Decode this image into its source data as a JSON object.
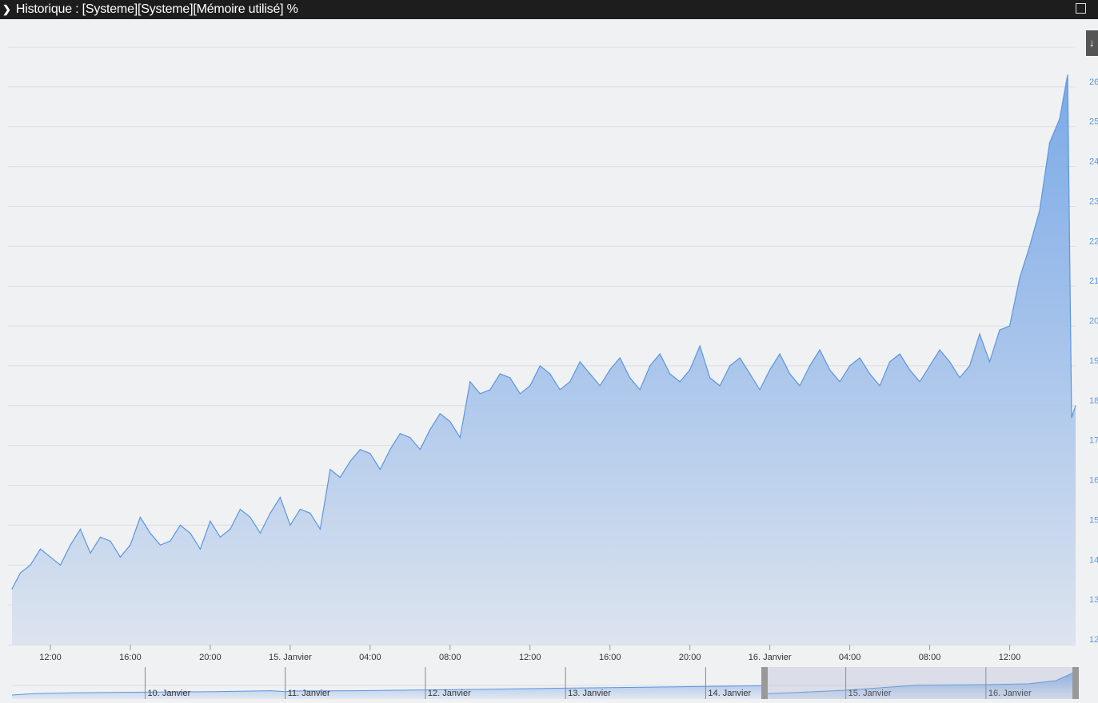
{
  "window": {
    "title": "Historique : [Systeme][Systeme][Mémoire utilisé] %",
    "expand_icon": "chevron-right-icon",
    "maximize_icon": "square-icon",
    "download_icon": "download-icon"
  },
  "chart_data": {
    "type": "area",
    "title": "Historique : [Systeme][Systeme][Mémoire utilisé] %",
    "xlabel": "",
    "ylabel": "",
    "x_unit": "hours since 14 Janvier 10:00",
    "ylim": [
      12,
      27
    ],
    "yticks": [
      12,
      13,
      14,
      15,
      16,
      17,
      18,
      19,
      20,
      21,
      22,
      23,
      24,
      25,
      26
    ],
    "ytick_labels": [
      "12",
      "13",
      "14",
      "15",
      "16",
      "17",
      "18",
      "19",
      "20",
      "21",
      "22",
      "23",
      "24",
      "25",
      "26"
    ],
    "xlim": [
      0.08,
      53.3
    ],
    "xticks": [
      {
        "h": 2,
        "label": "12:00"
      },
      {
        "h": 6,
        "label": "16:00"
      },
      {
        "h": 10,
        "label": "20:00"
      },
      {
        "h": 14,
        "label": "15. Janvier"
      },
      {
        "h": 18,
        "label": "04:00"
      },
      {
        "h": 22,
        "label": "08:00"
      },
      {
        "h": 26,
        "label": "12:00"
      },
      {
        "h": 30,
        "label": "16:00"
      },
      {
        "h": 34,
        "label": "20:00"
      },
      {
        "h": 38,
        "label": "16. Janvier"
      },
      {
        "h": 42,
        "label": "04:00"
      },
      {
        "h": 46,
        "label": "08:00"
      },
      {
        "h": 50,
        "label": "12:00"
      }
    ],
    "grid": true,
    "legend": "none",
    "color": "#5b96e0",
    "series": [
      {
        "name": "Mémoire utilisé %",
        "x": [
          0.08,
          0.5,
          1,
          1.5,
          2,
          2.5,
          3,
          3.5,
          4,
          4.5,
          5,
          5.5,
          6,
          6.5,
          7,
          7.5,
          8,
          8.5,
          9,
          9.5,
          10,
          10.5,
          11,
          11.5,
          12,
          12.5,
          13,
          13.5,
          14,
          14.5,
          15,
          15.5,
          16,
          16.5,
          17,
          17.5,
          18,
          18.5,
          19,
          19.5,
          20,
          20.5,
          21,
          21.5,
          22,
          22.5,
          23,
          23.5,
          24,
          24.5,
          25,
          25.5,
          26,
          26.5,
          27,
          27.5,
          28,
          28.5,
          29,
          29.5,
          30,
          30.5,
          31,
          31.5,
          32,
          32.5,
          33,
          33.5,
          34,
          34.5,
          35,
          35.5,
          36,
          36.5,
          37,
          37.5,
          38,
          38.5,
          39,
          39.5,
          40,
          40.5,
          41,
          41.5,
          42,
          42.5,
          43,
          43.5,
          44,
          44.5,
          45,
          45.5,
          46,
          46.5,
          47,
          47.5,
          48,
          48.5,
          49,
          49.5,
          50,
          50.5,
          51,
          51.5,
          52,
          52.5,
          52.9,
          53.1,
          53.3
        ],
        "values": [
          13.4,
          13.8,
          14.0,
          14.4,
          14.2,
          14.0,
          14.5,
          14.9,
          14.3,
          14.7,
          14.6,
          14.2,
          14.5,
          15.2,
          14.8,
          14.5,
          14.6,
          15.0,
          14.8,
          14.4,
          15.1,
          14.7,
          14.9,
          15.4,
          15.2,
          14.8,
          15.3,
          15.7,
          15.0,
          15.4,
          15.3,
          14.9,
          16.4,
          16.2,
          16.6,
          16.9,
          16.8,
          16.4,
          16.9,
          17.3,
          17.2,
          16.9,
          17.4,
          17.8,
          17.6,
          17.2,
          18.6,
          18.3,
          18.4,
          18.8,
          18.7,
          18.3,
          18.5,
          19.0,
          18.8,
          18.4,
          18.6,
          19.1,
          18.8,
          18.5,
          18.9,
          19.2,
          18.7,
          18.4,
          19.0,
          19.3,
          18.8,
          18.6,
          18.9,
          19.5,
          18.7,
          18.5,
          19.0,
          19.2,
          18.8,
          18.4,
          18.9,
          19.3,
          18.8,
          18.5,
          19.0,
          19.4,
          18.9,
          18.6,
          19.0,
          19.2,
          18.8,
          18.5,
          19.1,
          19.3,
          18.9,
          18.6,
          19.0,
          19.4,
          19.1,
          18.7,
          19.0,
          19.8,
          19.1,
          19.9,
          20.0,
          21.2,
          22.0,
          22.9,
          24.6,
          25.2,
          26.3,
          17.7,
          18.0
        ]
      }
    ],
    "navigator": {
      "x_unit": "days since 9 Janvier 00:00",
      "xlim": [
        0.05,
        7.64
      ],
      "labels": [
        {
          "d": 1,
          "label": "10. Janvier"
        },
        {
          "d": 2,
          "label": "11. Janvier"
        },
        {
          "d": 3,
          "label": "12. Janvier"
        },
        {
          "d": 4,
          "label": "13. Janvier"
        },
        {
          "d": 5,
          "label": "14. Janvier"
        },
        {
          "d": 6,
          "label": "15. Janvier"
        },
        {
          "d": 7,
          "label": "16. Janvier"
        }
      ],
      "x": [
        0.05,
        0.2,
        0.5,
        1.0,
        1.5,
        1.9,
        2.0,
        2.05,
        2.5,
        3.0,
        3.5,
        4.0,
        4.5,
        5.0,
        5.4,
        5.42,
        6.0,
        6.5,
        7.0,
        7.3,
        7.5,
        7.62,
        7.64
      ],
      "values": [
        12.5,
        13.3,
        13.9,
        14.3,
        14.6,
        15.2,
        14.6,
        15.0,
        15.2,
        15.7,
        16.2,
        16.8,
        17.3,
        17.9,
        18.3,
        13.2,
        15.5,
        18.6,
        19.0,
        19.5,
        21.5,
        26.3,
        26.5
      ],
      "ylim": [
        10,
        30
      ],
      "selection": [
        5.42,
        7.64
      ]
    }
  }
}
